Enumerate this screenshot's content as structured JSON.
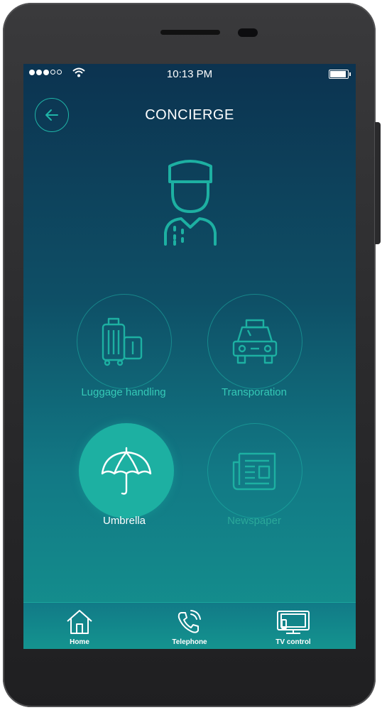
{
  "status": {
    "time": "10:13 PM"
  },
  "header": {
    "title": "CONCIERGE"
  },
  "services": [
    {
      "label": "Luggage handling",
      "icon": "luggage-icon"
    },
    {
      "label": "Transporation",
      "icon": "taxi-icon"
    },
    {
      "label": "Umbrella",
      "icon": "umbrella-icon",
      "selected": true
    },
    {
      "label": "Newspaper",
      "icon": "newspaper-icon"
    }
  ],
  "nav": [
    {
      "label": "Home",
      "icon": "home-icon"
    },
    {
      "label": "Telephone",
      "icon": "telephone-icon"
    },
    {
      "label": "TV control",
      "icon": "tv-icon"
    }
  ],
  "colors": {
    "accent": "#1db0a2",
    "bg_top": "#0c3350",
    "bg_bottom": "#14938f"
  }
}
